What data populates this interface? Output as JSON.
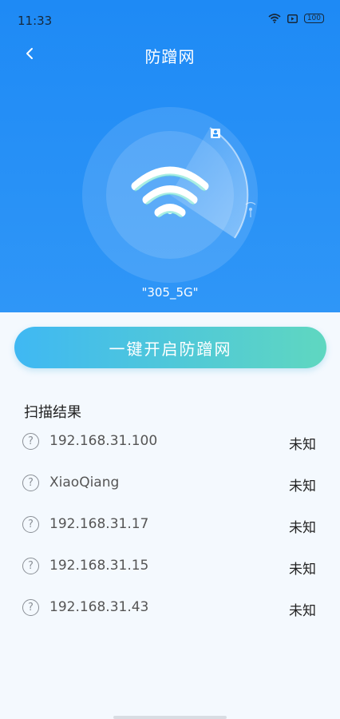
{
  "status_bar": {
    "time": "11:33",
    "battery": "100"
  },
  "header": {
    "title": "防蹭网"
  },
  "network": {
    "ssid": "\"305_5G\""
  },
  "actions": {
    "primary_label": "一键开启防蹭网"
  },
  "results": {
    "title": "扫描结果",
    "items": [
      {
        "name": "192.168.31.100",
        "status": "未知"
      },
      {
        "name": "XiaoQiang",
        "status": "未知"
      },
      {
        "name": "192.168.31.17",
        "status": "未知"
      },
      {
        "name": "192.168.31.15",
        "status": "未知"
      },
      {
        "name": "192.168.31.43",
        "status": "未知"
      }
    ],
    "unknown_icon_glyph": "?"
  },
  "colors": {
    "hero_blue": "#1e8af5",
    "button_start": "#3fb8f3",
    "button_end": "#5fd7c0",
    "page_bg": "#f4f9fe"
  }
}
